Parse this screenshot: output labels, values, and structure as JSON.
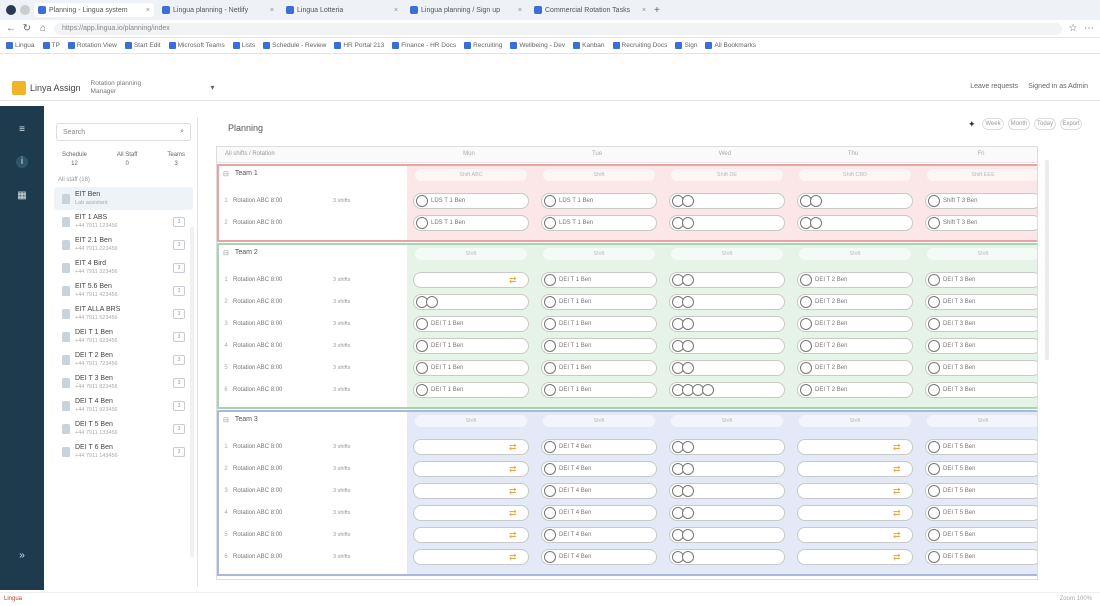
{
  "browser": {
    "tabs": [
      "Planning - Lingua system",
      "Lingua planning - Netlify",
      "Lingua Lotteria",
      "Lingua planning / Sign up",
      "Commercial Rotation Tasks"
    ],
    "url": "https://app.lingua.io/planning/index",
    "bookmarks": [
      "Lingua",
      "TP",
      "Rotation View",
      "Start Edit",
      "Microsoft Teams",
      "Lists",
      "Schedule - Review",
      "HR Portal 213",
      "Finance - HR Docs",
      "Recruiting",
      "Wellbeing - Dev",
      "Kanban",
      "Recruiting Docs",
      "Sign",
      "All Bookmarks"
    ]
  },
  "app": {
    "name": "Linya Assign",
    "project_line1": "Rotation planning",
    "project_line2": "Manager",
    "header_right": [
      "Leave requests",
      "Signed in as Admin"
    ]
  },
  "staff": {
    "search_placeholder": "Search",
    "filters": [
      {
        "label": "Schedule",
        "value": "12"
      },
      {
        "label": "All Staff",
        "value": "0"
      },
      {
        "label": "Teams",
        "value": "3"
      }
    ],
    "section": "All staff (18)",
    "items": [
      {
        "name": "EIT Ben",
        "sub": "Lab assistant",
        "badge": ""
      },
      {
        "name": "EIT 1 ABS",
        "sub": "+44 7911 123456",
        "badge": "3"
      },
      {
        "name": "EIT 2.1 Ben",
        "sub": "+44 7911 223456",
        "badge": "3"
      },
      {
        "name": "EIT 4 Bird",
        "sub": "+44 7911 323456",
        "badge": "3"
      },
      {
        "name": "EIT 5.6 Ben",
        "sub": "+44 7911 423456",
        "badge": "3"
      },
      {
        "name": "EIT ALLA BRS",
        "sub": "+44 7911 523456",
        "badge": "3"
      },
      {
        "name": "DEI T 1 Ben",
        "sub": "+44 7911 623456",
        "badge": "3"
      },
      {
        "name": "DEI T 2 Ben",
        "sub": "+44 7911 723456",
        "badge": "3"
      },
      {
        "name": "DEI T 3 Ben",
        "sub": "+44 7911 823456",
        "badge": "3"
      },
      {
        "name": "DEI T 4 Ben",
        "sub": "+44 7911 923456",
        "badge": "3"
      },
      {
        "name": "DEI T 5 Ben",
        "sub": "+44 7911 133456",
        "badge": "3"
      },
      {
        "name": "DEI T 6 Ben",
        "sub": "+44 7911 143456",
        "badge": "3"
      }
    ]
  },
  "main": {
    "title": "Planning",
    "header_label": "All shifts / Rotation",
    "columns": [
      "Mon",
      "Tue",
      "Wed",
      "Thu",
      "Fri"
    ],
    "tools": [
      "Week",
      "Month",
      "Today",
      "Export"
    ],
    "teams": [
      {
        "name": "Team 1",
        "color": "#e9a3a3",
        "bg": "#fbe7e7",
        "captions": [
          "Shift ABC",
          "Shift",
          "Shift DE",
          "Shift CBD",
          "Shift EEE"
        ],
        "rows": [
          {
            "n": "1",
            "name": "Rotation ABC 8:00",
            "role": "3 shifts",
            "cells": [
              "c:LDS T 1 Ben",
              "c:LDS T 1 Ben",
              "cc:",
              "cc:",
              "c:Shift T 3 Ben"
            ]
          },
          {
            "n": "2",
            "name": "Rotation ABC 8:00",
            "role": "",
            "cells": [
              "c:LDS T 1 Ben",
              "c:LDS T 1 Ben",
              "cc:",
              "cc:",
              "c:Shift T 3 Ben"
            ]
          }
        ]
      },
      {
        "name": "Team 2",
        "color": "#a8d3b0",
        "bg": "#e6f4e8",
        "captions": [
          "Shift",
          "Shift",
          "Shift",
          "Shift",
          "Shift"
        ],
        "rows": [
          {
            "n": "1",
            "name": "Rotation ABC 8:00",
            "role": "3 shifts",
            "cells": [
              "s:",
              "c:DEI T 1 Ben",
              "cc:",
              "c:DEI T 2 Ben",
              "c:DEI T 3 Ben"
            ]
          },
          {
            "n": "2",
            "name": "Rotation ABC 8:00",
            "role": "3 shifts",
            "cells": [
              "cc:",
              "c:DEI T 1 Ben",
              "cc:",
              "c:DEI T 2 Ben",
              "c:DEI T 3 Ben"
            ]
          },
          {
            "n": "3",
            "name": "Rotation ABC 8:00",
            "role": "3 shifts",
            "cells": [
              "c:DEI T 1 Ben",
              "c:DEI T 1 Ben",
              "cc:",
              "c:DEI T 2 Ben",
              "c:DEI T 3 Ben"
            ]
          },
          {
            "n": "4",
            "name": "Rotation ABC 8:00",
            "role": "3 shifts",
            "cells": [
              "c:DEI T 1 Ben",
              "c:DEI T 1 Ben",
              "cc:",
              "c:DEI T 2 Ben",
              "c:DEI T 3 Ben"
            ]
          },
          {
            "n": "5",
            "name": "Rotation ABC 8:00",
            "role": "3 shifts",
            "cells": [
              "c:DEI T 1 Ben",
              "c:DEI T 1 Ben",
              "cc:",
              "c:DEI T 2 Ben",
              "c:DEI T 3 Ben"
            ]
          },
          {
            "n": "6",
            "name": "Rotation ABC 8:00",
            "role": "3 shifts",
            "cells": [
              "c:DEI T 1 Ben",
              "c:DEI T 1 Ben",
              "cccc:",
              "c:DEI T 2 Ben",
              "c:DEI T 3 Ben"
            ]
          }
        ]
      },
      {
        "name": "Team 3",
        "color": "#aab8db",
        "bg": "#e3e9f6",
        "captions": [
          "Shift",
          "Shift",
          "Shift",
          "Shift",
          "Shift"
        ],
        "rows": [
          {
            "n": "1",
            "name": "Rotation ABC 8:00",
            "role": "3 shifts",
            "cells": [
              "s:",
              "c:DEI T 4 Ben",
              "cc:",
              "s:",
              "c:DEI T 5 Ben"
            ]
          },
          {
            "n": "2",
            "name": "Rotation ABC 8:00",
            "role": "3 shifts",
            "cells": [
              "s:",
              "c:DEI T 4 Ben",
              "cc:",
              "s:",
              "c:DEI T 5 Ben"
            ]
          },
          {
            "n": "3",
            "name": "Rotation ABC 8:00",
            "role": "3 shifts",
            "cells": [
              "s:",
              "c:DEI T 4 Ben",
              "cc:",
              "s:",
              "c:DEI T 5 Ben"
            ]
          },
          {
            "n": "4",
            "name": "Rotation ABC 8:00",
            "role": "3 shifts",
            "cells": [
              "s:",
              "c:DEI T 4 Ben",
              "cc:",
              "s:",
              "c:DEI T 5 Ben"
            ]
          },
          {
            "n": "5",
            "name": "Rotation ABC 8:00",
            "role": "3 shifts",
            "cells": [
              "s:",
              "c:DEI T 4 Ben",
              "cc:",
              "s:",
              "c:DEI T 5 Ben"
            ]
          },
          {
            "n": "6",
            "name": "Rotation ABC 8:00",
            "role": "3 shifts",
            "cells": [
              "s:",
              "c:DEI T 4 Ben",
              "cc:",
              "s:",
              "c:DEI T 5 Ben"
            ]
          }
        ]
      }
    ]
  },
  "status": {
    "left": "Lingua",
    "right": "Zoom 100%"
  }
}
